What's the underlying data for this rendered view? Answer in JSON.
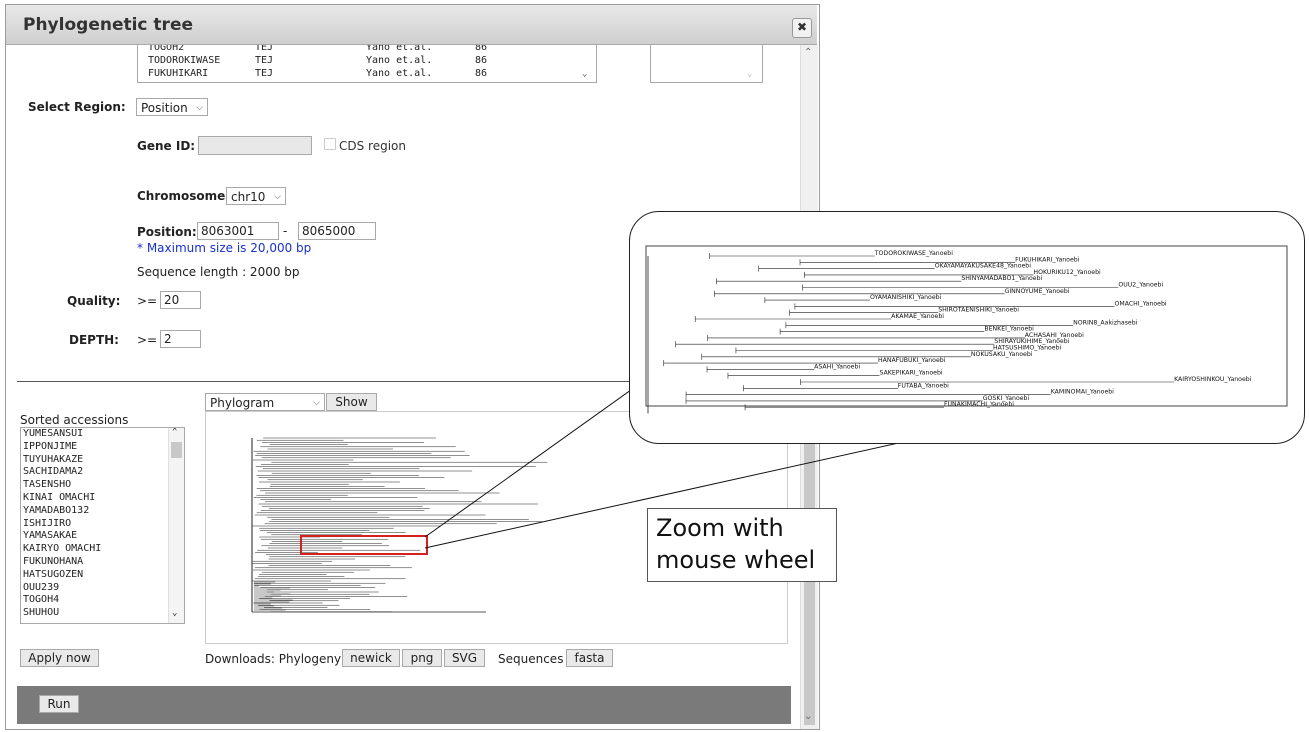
{
  "dialog": {
    "title": "Phylogenetic tree"
  },
  "accession_list": {
    "rows": [
      [
        "TOGOH2",
        "TEJ",
        "Yano et.al.",
        "86"
      ],
      [
        "TODOROKIWASE",
        "TEJ",
        "Yano et.al.",
        "86"
      ],
      [
        "FUKUHIKARI",
        "TEJ",
        "Yano et.al.",
        "86"
      ]
    ]
  },
  "region": {
    "label": "Select Region:",
    "mode": "Position",
    "gene_id_label": "Gene ID:",
    "cds_label": "CDS region",
    "chromosome_label": "Chromosome:",
    "chromosome": "chr10",
    "position_label": "Position:",
    "position_start": "8063001",
    "position_sep": "-",
    "position_end": "8065000",
    "max_size_note": "* Maximum size is 20,000 bp",
    "seq_length": "Sequence length :  2000 bp"
  },
  "filters": {
    "quality_label": "Quality:",
    "quality_op": ">=",
    "quality_value": "20",
    "depth_label": "DEPTH:",
    "depth_op": ">=",
    "depth_value": "2"
  },
  "sorted": {
    "label": "Sorted accessions",
    "items": [
      "YUMESANSUI",
      "IPPONJIME",
      "TUYUHAKAZE",
      "SACHIDAMA2",
      "TASENSHO",
      "KINAI OMACHI",
      "YAMADABO132",
      "ISHIJIRO",
      "YAMASAKAE",
      "KAIRYO OMACHI",
      "FUKUNOHANA",
      "HATSUGOZEN",
      "OUU239",
      "TOGOH4",
      "SHUHOU"
    ],
    "apply_label": "Apply now"
  },
  "tree_controls": {
    "tree_type": "Phylogram",
    "show_label": "Show"
  },
  "downloads": {
    "label": "Downloads: Phylogeny",
    "newick": "newick",
    "png": "png",
    "svg": "SVG",
    "seq_label": "Sequences",
    "fasta": "fasta"
  },
  "run_label": "Run",
  "callout": {
    "line1": "Zoom with",
    "line2": "mouse wheel"
  },
  "zoom_labels": [
    "TODOROKIWASE_Yanoebi",
    "FUKUHIKARI_Yanoebi",
    "OKAYAMAYAKUSAKE48_Yanoebi",
    "HOKURIKU12_Yanoebi",
    "SHINYAMADABO1_Yanoebi",
    "OUU2_Yanoebi",
    "GINNOYUME_Yanoebi",
    "OYAMANISHIKI_Yanoebi",
    "OMACHI_Yanoebi",
    "SHIROTAENISHIKI_Yanoebi",
    "AKAMAE_Yanoebi",
    "NORIN8_Aakizhasebi",
    "BENKEI_Yanoebi",
    "ACHASAHI_Yanoebi",
    "SHIRAYUKIHIME_Yanoebi",
    "HATSUSHIMO_Yanoebi",
    "NOKUSAKU_Yanoebi",
    "HANAFUBUKI_Yanoebi",
    "ASAHI_Yanoebi",
    "SAKEPIKARI_Yanoebi",
    "KAIRYOSHINKOU_Yanoebi",
    "FUTABA_Yanoebi",
    "KAMINOMAI_Yanoebi",
    "GOSKI_Yanoebi",
    "FUNAKIMACHI_Yanoebi"
  ],
  "colors": {
    "highlight": "#d62020",
    "footer": "#7a7a7a",
    "link": "#1a2fd0"
  }
}
